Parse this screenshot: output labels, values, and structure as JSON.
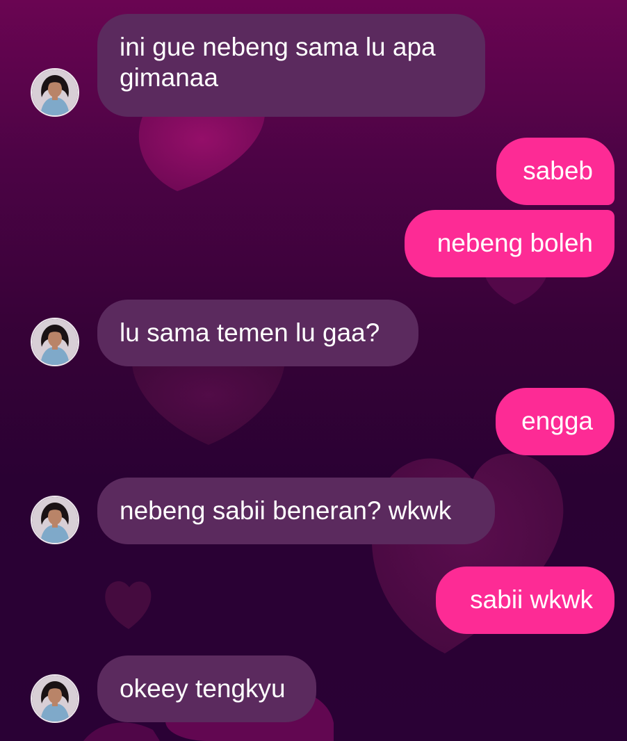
{
  "theme": {
    "incoming_bubble_color": "#5b2a5e",
    "outgoing_bubble_color": "#fd2b95",
    "text_color": "#ffffff",
    "background_top": "#6a0552",
    "background_bottom": "#2a0135"
  },
  "messages": [
    {
      "side": "incoming",
      "lines": [
        "ini gue nebeng sama lu apa",
        "gimanaa"
      ],
      "avatar": "contact-avatar"
    },
    {
      "side": "outgoing",
      "lines": [
        "sabeb"
      ]
    },
    {
      "side": "outgoing",
      "lines": [
        "nebeng boleh"
      ]
    },
    {
      "side": "incoming",
      "lines": [
        "lu sama temen lu gaa?"
      ],
      "avatar": "contact-avatar"
    },
    {
      "side": "outgoing",
      "lines": [
        "engga"
      ]
    },
    {
      "side": "incoming",
      "lines": [
        "nebeng sabii beneran? wkwk"
      ],
      "avatar": "contact-avatar"
    },
    {
      "side": "outgoing",
      "lines": [
        "sabii wkwk"
      ]
    },
    {
      "side": "incoming",
      "lines": [
        "okeey tengkyu"
      ],
      "avatar": "contact-avatar"
    }
  ]
}
